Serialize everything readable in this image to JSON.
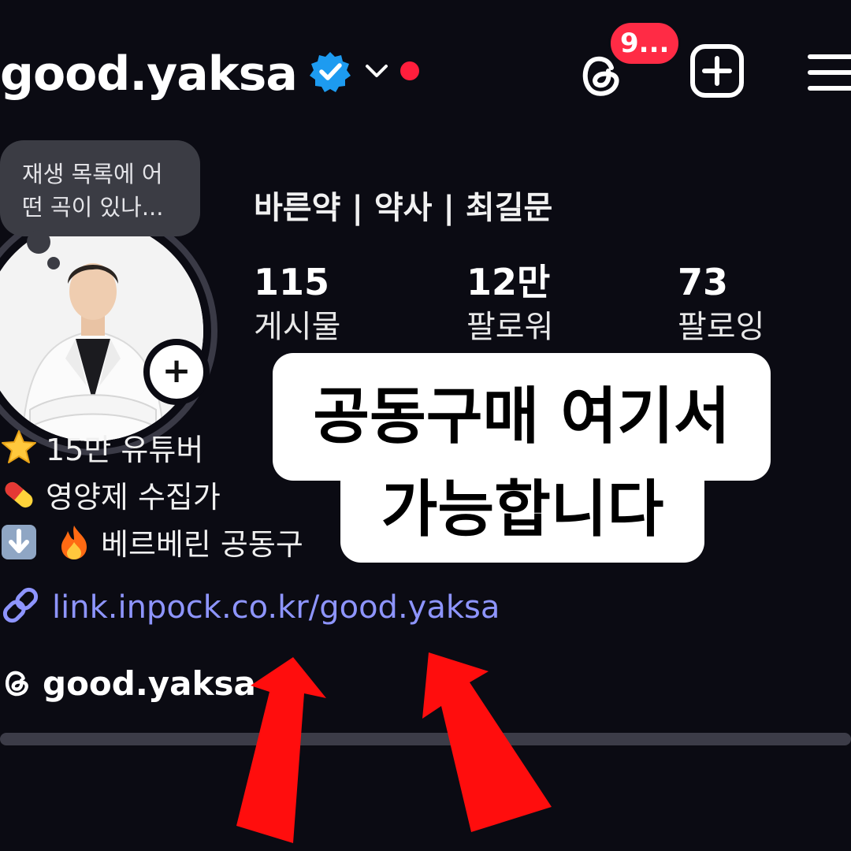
{
  "header": {
    "username": "good.yaksa",
    "notification_count": "9...",
    "icons": {
      "verified": "verified-badge-icon",
      "switch_account": "chevron-down-icon",
      "threads": "threads-icon",
      "new_post": "plus-square-icon",
      "menu": "hamburger-menu-icon"
    }
  },
  "note": {
    "text_line1": "재생 목록에 어",
    "text_line2": "떤 곡이 있나..."
  },
  "profile": {
    "display_name": "바른약 | 약사 | 최길문",
    "stats": [
      {
        "count": "115",
        "label": "게시물"
      },
      {
        "count": "12만",
        "label": "팔로워"
      },
      {
        "count": "73",
        "label": "팔로잉"
      }
    ]
  },
  "bio": {
    "line1": "15만 유튜버",
    "line2": "영양제 수집가",
    "line3": "베르베린 공동구",
    "link": "link.inpock.co.kr/good.yaksa",
    "threads_handle": "good.yaksa",
    "emoji_icons": [
      "star-icon",
      "pill-icon",
      "down-arrow-icon",
      "fire-icon"
    ]
  },
  "overlay": {
    "caption_line1": "공동구매 여기서",
    "caption_line2": "가능합니다"
  },
  "colors": {
    "background": "#0b0b13",
    "link": "#8e95ff",
    "badge": "#ff2b45",
    "verified": "#1d9bf0",
    "arrow": "#ff1010"
  }
}
